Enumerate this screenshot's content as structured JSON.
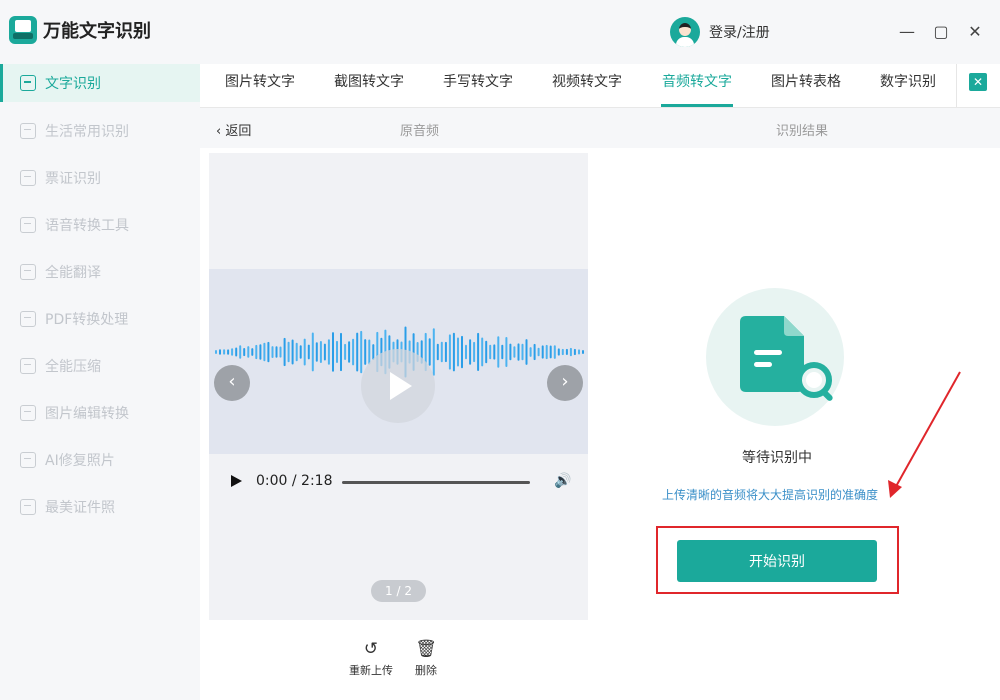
{
  "app": {
    "name": "万能文字识别"
  },
  "header": {
    "user_label": "登录/注册",
    "min_icon": "—",
    "max_icon": "▢",
    "close_icon": "✕"
  },
  "sidebar": {
    "items": [
      {
        "label": "文字识别",
        "active": true
      },
      {
        "label": "生活常用识别"
      },
      {
        "label": "票证识别"
      },
      {
        "label": "语音转换工具"
      },
      {
        "label": "全能翻译"
      },
      {
        "label": "PDF转换处理"
      },
      {
        "label": "全能压缩"
      },
      {
        "label": "图片编辑转换"
      },
      {
        "label": "AI修复照片"
      },
      {
        "label": "最美证件照"
      }
    ]
  },
  "tabs": {
    "items": [
      {
        "label": "图片转文字"
      },
      {
        "label": "截图转文字"
      },
      {
        "label": "手写转文字"
      },
      {
        "label": "视频转文字"
      },
      {
        "label": "音频转文字",
        "active": true
      },
      {
        "label": "图片转表格"
      },
      {
        "label": "数字识别"
      }
    ],
    "close_icon": "✕"
  },
  "subheader": {
    "back_label": "返回",
    "back_icon": "‹",
    "left_title": "原音频",
    "right_title": "识别结果"
  },
  "audio": {
    "prev_icon": "‹",
    "next_icon": "›",
    "time": "0:00 / 2:18",
    "volume_icon": "🔊",
    "page_indicator": "1 / 2",
    "progress": 0.0
  },
  "actions": {
    "reupload_label": "重新上传",
    "reupload_icon": "↺",
    "delete_label": "删除",
    "delete_icon": "🗑"
  },
  "result": {
    "status": "等待识别中",
    "hint": "上传清晰的音频将大大提高识别的准确度",
    "start_button": "开始识别"
  },
  "colors": {
    "accent": "#1ba99b",
    "highlight": "#e0262b",
    "hint": "#3a8fc8"
  }
}
